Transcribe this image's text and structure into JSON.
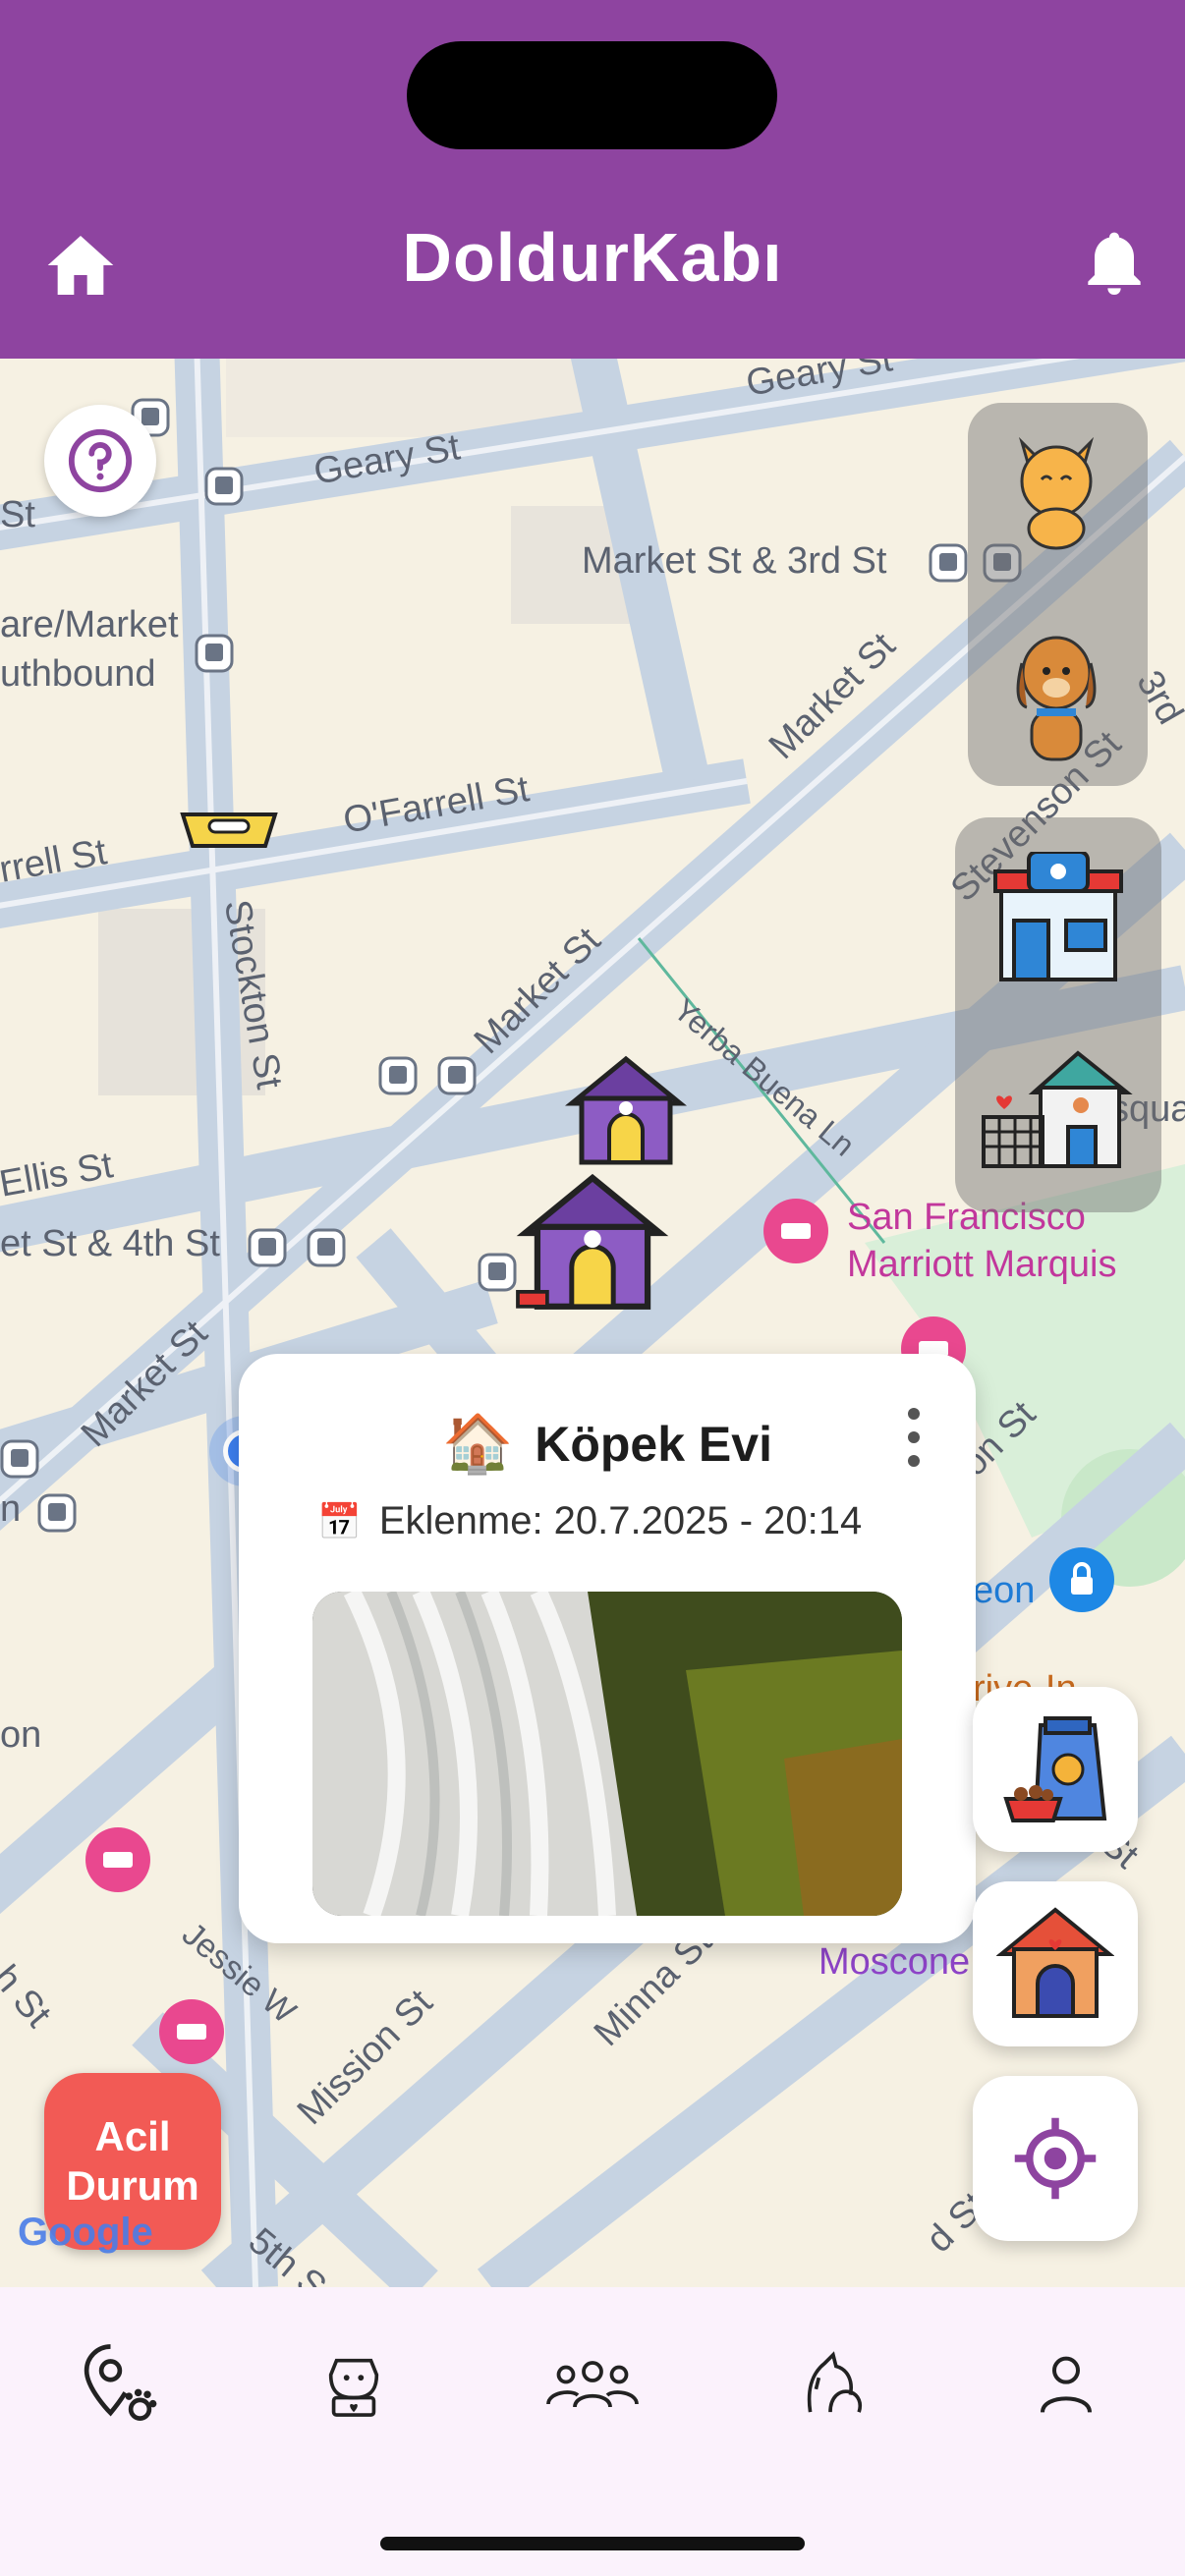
{
  "app": {
    "title": "DoldurKabı"
  },
  "header": {
    "home_icon": "home-icon",
    "notification_icon": "bell-icon"
  },
  "map": {
    "streets": [
      {
        "id": "geary-1",
        "label": "Geary St"
      },
      {
        "id": "geary-2",
        "label": "Geary St"
      },
      {
        "id": "market-3rd",
        "label": "Market St & 3rd St"
      },
      {
        "id": "square-market",
        "label": "are/Market"
      },
      {
        "id": "southbound",
        "label": "uthbound"
      },
      {
        "id": "market-1",
        "label": "Market St"
      },
      {
        "id": "ofarrell",
        "label": "O'Farrell St"
      },
      {
        "id": "farrell",
        "label": "rrell St"
      },
      {
        "id": "stockton",
        "label": "Stockton St"
      },
      {
        "id": "market-2",
        "label": "Market St"
      },
      {
        "id": "stevenson",
        "label": "Stevenson St"
      },
      {
        "id": "yerba",
        "label": "Yerba Buena Ln"
      },
      {
        "id": "ellis",
        "label": "Ellis St"
      },
      {
        "id": "market-4th",
        "label": "et St & 4th St"
      },
      {
        "id": "market-3",
        "label": "Market St"
      },
      {
        "id": "jessie",
        "label": "Jessie W"
      },
      {
        "id": "mission",
        "label": "Mission St"
      },
      {
        "id": "minna",
        "label": "Minna St"
      },
      {
        "id": "fifth",
        "label": "5th S"
      },
      {
        "id": "st-left",
        "label": "St"
      },
      {
        "id": "on-left",
        "label": "on"
      },
      {
        "id": "n-left",
        "label": "n"
      },
      {
        "id": "h-st",
        "label": "h St"
      },
      {
        "id": "3rd-right",
        "label": "3rd"
      },
      {
        "id": "on-st",
        "label": "on St"
      },
      {
        "id": "st-right",
        "label": "St"
      },
      {
        "id": "d-st",
        "label": "d St"
      }
    ],
    "pois": [
      {
        "id": "marriott",
        "label": "San Francisco\nMarriott Marquis"
      },
      {
        "id": "moscone",
        "label": "Moscone"
      },
      {
        "id": "eon",
        "label": "eon"
      },
      {
        "id": "squa",
        "label": "squa"
      },
      {
        "id": "driving",
        "label": "rive-In"
      }
    ]
  },
  "popup": {
    "emoji": "🏠",
    "title": "Köpek Evi",
    "calendar_emoji": "📅",
    "date_text": "Eklenme: 20.7.2025 - 20:14"
  },
  "emergency": {
    "label": "Acil Durum"
  },
  "google": "Google",
  "nav": [
    {
      "id": "map",
      "icon": "map-paw-pin-icon"
    },
    {
      "id": "adopt",
      "icon": "dog-heart-icon"
    },
    {
      "id": "community",
      "icon": "people-group-icon"
    },
    {
      "id": "pets",
      "icon": "cat-dog-icon"
    },
    {
      "id": "profile",
      "icon": "person-icon"
    }
  ],
  "colors": {
    "header": "#8e44a0",
    "accent": "#8e44a0",
    "emergency": "#f25a55",
    "poi": "#c2379c"
  }
}
